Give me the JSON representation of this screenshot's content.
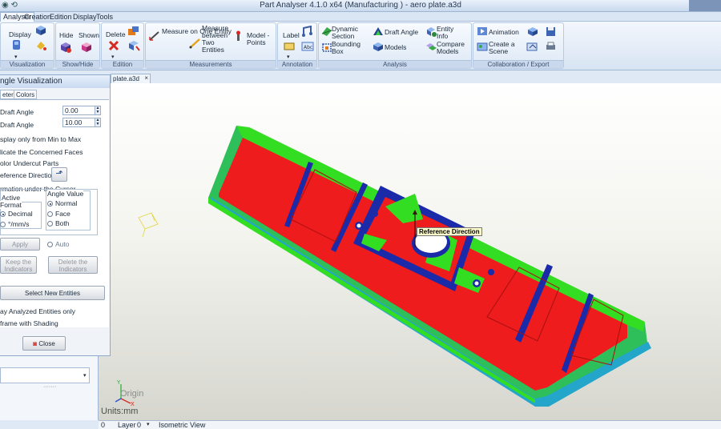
{
  "window": {
    "title": "Part Analyser 4.1.0 x64 (Manufacturing ) - aero plate.a3d"
  },
  "menu": {
    "tabs": [
      "Analyser",
      "Creation",
      "Edition",
      "Display",
      "Tools"
    ],
    "active": "Analyser"
  },
  "ribbon": {
    "groups": [
      {
        "label": "Visualization",
        "items": [
          "Display"
        ]
      },
      {
        "label": "Show/Hide",
        "items": [
          "Hide",
          "Shown"
        ]
      },
      {
        "label": "Edition",
        "items": [
          "Delete"
        ]
      },
      {
        "label": "Measurements",
        "items": [
          "Measure on One Entity",
          "Measure between Two Entities",
          "Model - Points"
        ]
      },
      {
        "label": "Annotation",
        "items": [
          "Label"
        ]
      },
      {
        "label": "Analysis",
        "items": [
          "Dynamic Section",
          "Bounding Box",
          "Draft Angle",
          "Models",
          "Entity Info",
          "Compare Models"
        ]
      },
      {
        "label": "Collaboration / Export",
        "items": [
          "Animation",
          "Create a Scene"
        ]
      }
    ]
  },
  "doc_tab": {
    "label": "plate.a3d"
  },
  "dialog": {
    "title": "ngle Visualization",
    "tabs": [
      "eters",
      "Colors"
    ],
    "min_draft_label": "Draft Angle",
    "min_draft_value": "0.00",
    "max_draft_label": "Draft Angle",
    "max_draft_value": "10.00",
    "display_min_max": "splay only from Min to Max",
    "indicate_faces": "licate the Concerned Faces",
    "color_undercut": "olor Undercut Parts",
    "reference_direction": "eference Direction",
    "info_section": "rmation under the Cursor",
    "active": "Active",
    "format_label": "Format",
    "format_decimal": "Decimal",
    "format_mms": "°/mm/s",
    "angle_value_label": "Angle Value",
    "angle_normal": "Normal",
    "angle_face": "Face",
    "angle_both": "Both",
    "apply_button": "Apply",
    "auto_label": "Auto",
    "keep_button_l1": "Keep the",
    "keep_button_l2": "Indicators",
    "delete_button_l1": "Delete the",
    "delete_button_l2": "Indicators",
    "select_new_entities": "Select New Entities",
    "display_analyzed_only": "ay Analyzed Entities only",
    "wireframe_shading": "frame with Shading",
    "close_button": "Close"
  },
  "viewport": {
    "reference_label": "Reference Direction",
    "origin_label": "Origin",
    "units_label": "Units:mm"
  },
  "statusbar": {
    "field0": "0",
    "layer_label": "Layer",
    "layer_value": "0",
    "view_name": "Isometric View"
  },
  "colors": {
    "draft_ok": "#33dd22",
    "draft_zero": "#ee1c1c",
    "undercut": "#1a2aa8",
    "transition": "#23a6c9"
  }
}
